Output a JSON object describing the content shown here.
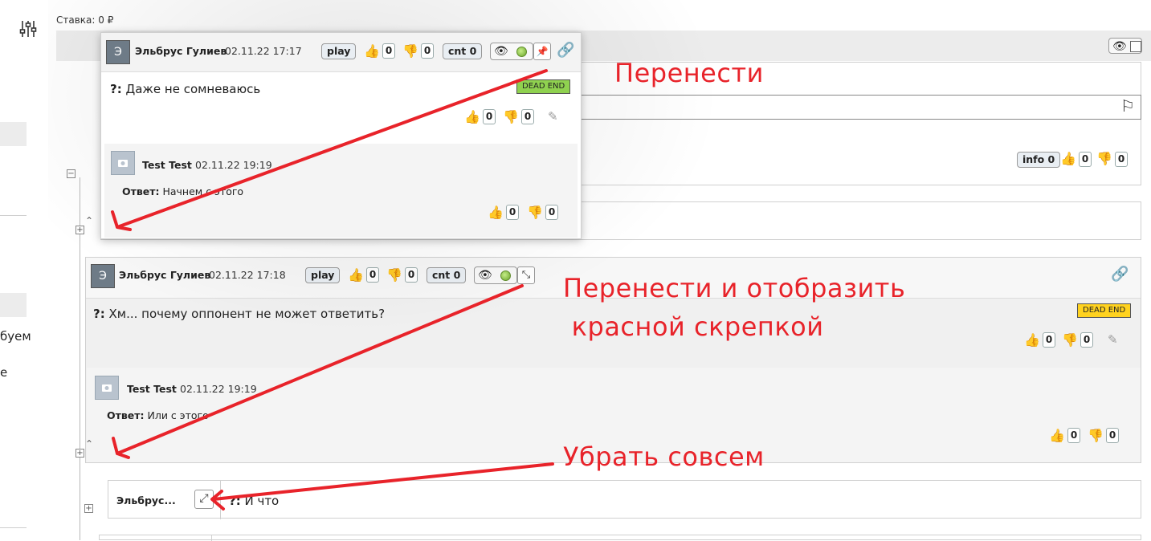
{
  "top": {
    "stake_label": "Ставка: 0 ₽"
  },
  "sidebar": {
    "partial_text_1": "буем",
    "partial_text_2": "е"
  },
  "header_controls": {
    "eye_icon": "👁"
  },
  "popup_card": {
    "avatar_letter": "Э",
    "author": "Эльбрус Гулиев",
    "date": "02.11.22 17:17",
    "play_label": "play",
    "likes": "0",
    "dislikes": "0",
    "cnt_label": "cnt 0",
    "question_prefix": "?:",
    "question_text": " Даже не сомневаюсь",
    "dead_end_label": "DEAD END",
    "q_likes": "0",
    "q_dislikes": "0",
    "answer": {
      "author": "Test Test",
      "date": "02.11.22 19:19",
      "answer_prefix": "Ответ:",
      "answer_text": " Начнем с этого",
      "likes": "0",
      "dislikes": "0"
    }
  },
  "background_card": {
    "info_label": "info 0",
    "likes": "0",
    "dislikes": "0"
  },
  "card2": {
    "avatar_letter": "Э",
    "author": "Эльбрус Гулиев",
    "date": "02.11.22 17:18",
    "play_label": "play",
    "likes": "0",
    "dislikes": "0",
    "cnt_label": "cnt 0",
    "question_prefix": "?:",
    "question_text": " Хм... почему оппонент не может ответить?",
    "dead_end_label": "DEAD END",
    "q_likes": "0",
    "q_dislikes": "0",
    "answer": {
      "author": "Test Test",
      "date": "02.11.22 19:19",
      "answer_prefix": "Ответ:",
      "answer_text": " Или с этого",
      "likes": "0",
      "dislikes": "0"
    }
  },
  "collapsed_row": {
    "author_short": "Эльбрус...",
    "question_prefix": "?:",
    "question_text": " И что"
  },
  "annotations": {
    "a1": "Перенести",
    "a2_line1": "Перенести и отобразить",
    "a2_line2": " красной скрепкой",
    "a3": "Убрать совсем"
  },
  "colors": {
    "annotation_red": "#e8232a",
    "dead_end_green": "#8fd14f",
    "dead_end_yellow": "#ffd21f"
  }
}
